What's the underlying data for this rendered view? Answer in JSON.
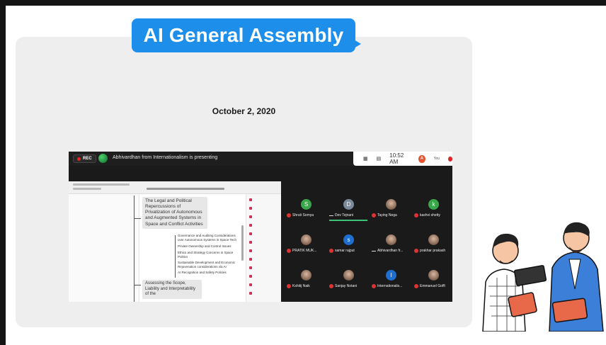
{
  "header": {
    "title": "AI General Assembly",
    "date": "October 2, 2020"
  },
  "meeting": {
    "rec_label": "REC",
    "presenting_text": "Abhivardhan from Internationalism is presenting",
    "time": "10:52 AM",
    "user_initial": "A",
    "you_label": "You",
    "doc": {
      "main_node": "The Legal and Political Repercussions of Privatization of Autonomous and Augmented Systems in Space and Conflict Activities",
      "leaves": [
        "Governance and Auditing Considerations over Autonomous Systems in Space Tech",
        "Private Ownership and Control Issues",
        "Ethics and Strategy Concerns in Space Politics",
        "Sustainable Development and Economic Rejuvenation considerations via AI",
        "AI Recognition and Safety Policies"
      ],
      "second_node": "Assessing the Scope, Liability and Interpretability of the"
    },
    "participants": [
      {
        "name": "Shruti Somya",
        "initial": "S",
        "color": "#3aa64a",
        "muted": true
      },
      {
        "name": "Dev Tejnani",
        "initial": "D",
        "color": "#7a8a9a",
        "muted": false,
        "speaking": true
      },
      {
        "name": "Taying Nega",
        "initial": "",
        "color": "",
        "muted": true,
        "photo": true
      },
      {
        "name": "kashvi shetty",
        "initial": "k",
        "color": "#3aa64a",
        "muted": true
      },
      {
        "name": "PRATIK MUK...",
        "initial": "",
        "color": "",
        "muted": true,
        "photo": true
      },
      {
        "name": "samar rajput",
        "initial": "s",
        "color": "#1e6fd0",
        "muted": true
      },
      {
        "name": "Abhivardhan fr...",
        "initial": "",
        "color": "",
        "muted": false,
        "photo": true
      },
      {
        "name": "prakhar prakash",
        "initial": "",
        "color": "",
        "muted": true,
        "photo": true
      },
      {
        "name": "Kshitij Naik",
        "initial": "",
        "color": "",
        "muted": true,
        "photo": true
      },
      {
        "name": "Sanjay Notani",
        "initial": "",
        "color": "",
        "muted": true,
        "photo": true
      },
      {
        "name": "Internationalis...",
        "initial": "I",
        "color": "#1e6fd0",
        "muted": true
      },
      {
        "name": "Emmanuel Goffi",
        "initial": "",
        "color": "",
        "muted": true,
        "photo": true
      }
    ]
  },
  "colors": {
    "accent": "#1d8fea",
    "card": "#eeeeee",
    "rec": "#dd2222"
  }
}
